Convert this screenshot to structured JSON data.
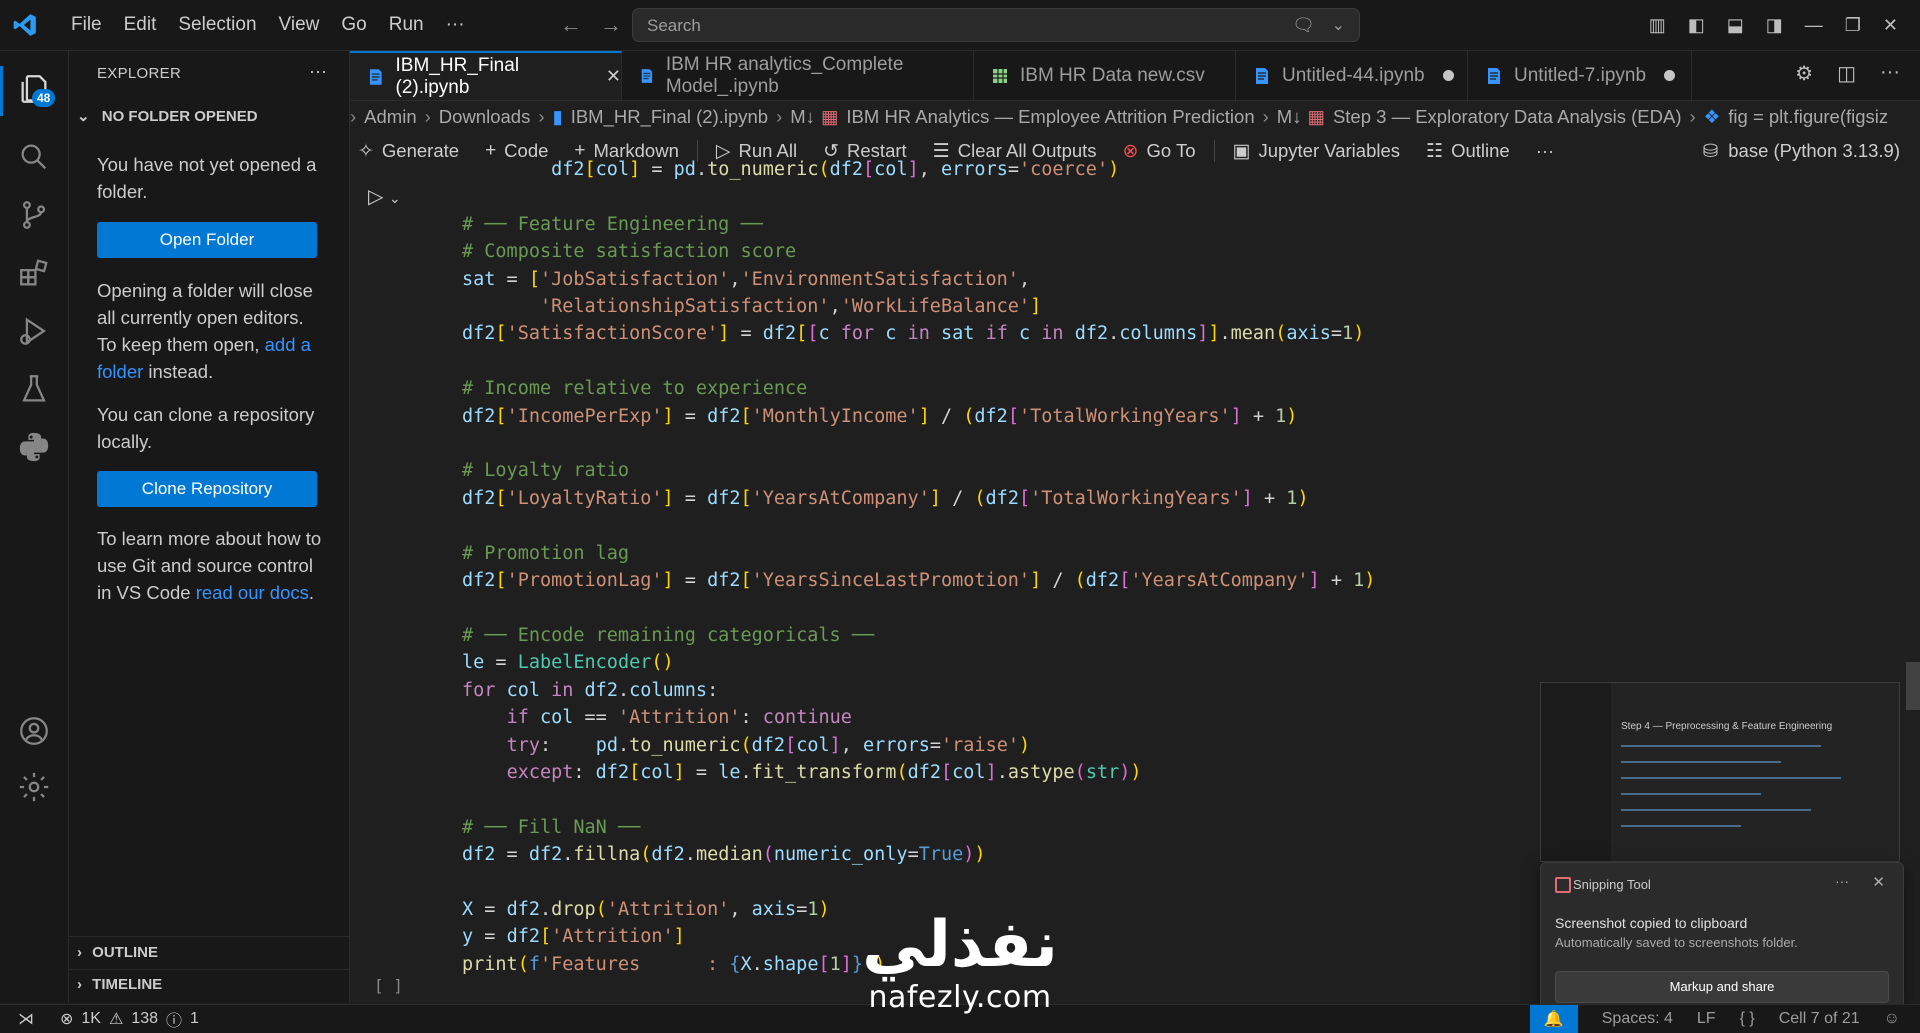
{
  "menu": [
    "File",
    "Edit",
    "Selection",
    "View",
    "Go",
    "Run",
    "···"
  ],
  "search": {
    "placeholder": "Search"
  },
  "activity": {
    "explorer_badge": "48"
  },
  "sidebar": {
    "title": "EXPLORER",
    "more": "···",
    "section": "NO FOLDER OPENED",
    "p1": "You have not yet opened a folder.",
    "open_folder": "Open Folder",
    "p2_a": "Opening a folder will close all currently open editors. To keep them open, ",
    "p2_link": "add a folder",
    "p2_b": " instead.",
    "p3": "You can clone a repository locally.",
    "clone_repo": "Clone Repository",
    "p4_a": "To learn more about how to use Git and source control in VS Code ",
    "p4_link": "read our docs",
    "p4_b": ".",
    "outline": "OUTLINE",
    "timeline": "TIMELINE"
  },
  "tabs": [
    {
      "label": "IBM_HR_Final (2).ipynb",
      "active": true
    },
    {
      "label": "IBM HR analytics_Complete Model_.ipynb"
    },
    {
      "label": "IBM HR Data new.csv"
    },
    {
      "label": "Untitled-44.ipynb",
      "dirty": true
    },
    {
      "label": "Untitled-7.ipynb",
      "dirty": true
    }
  ],
  "breadcrumb": [
    "Admin",
    "Downloads",
    "IBM_HR_Final (2).ipynb",
    "M↓",
    "IBM HR Analytics — Employee Attrition Prediction",
    "M↓",
    "Step 3 — Exploratory Data Analysis (EDA)",
    "fig = plt.figure(figsiz"
  ],
  "toolbar": {
    "generate": "Generate",
    "code": "Code",
    "markdown": "Markdown",
    "run_all": "Run All",
    "restart": "Restart",
    "clear_all": "Clear All Outputs",
    "go_to": "Go To",
    "jupyter_vars": "Jupyter Variables",
    "outline": "Outline",
    "more": "···",
    "kernel": "base (Python 3.13.9)"
  },
  "cell": {
    "exec_count": "[ ]"
  },
  "snipping": {
    "preview_heading": "Step 4 — Preprocessing & Feature Engineering",
    "app": "Snipping Tool",
    "title": "Screenshot copied to clipboard",
    "subtitle": "Automatically saved to screenshots folder.",
    "button": "Markup and share"
  },
  "statusbar": {
    "errors": "1K",
    "warnings": "138",
    "info": "1",
    "spaces": "Spaces: 4",
    "eol": "LF",
    "cell": "Cell 7 of 21"
  },
  "watermark": {
    "arabic": "نفذلي",
    "latin": "nafezly.com"
  }
}
